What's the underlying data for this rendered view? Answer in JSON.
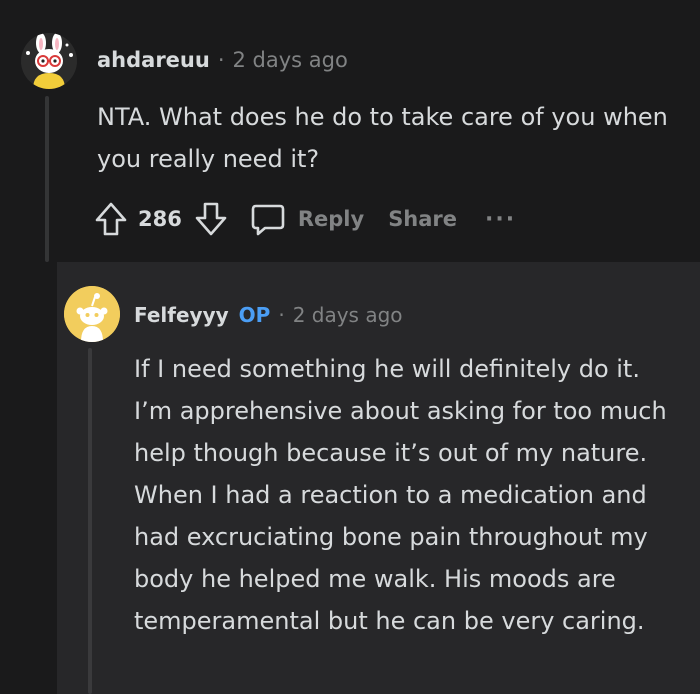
{
  "top_comment": {
    "username": "ahdareuu",
    "separator": "·",
    "timestamp": "2 days ago",
    "body": "NTA. What does he do to take care of you when you really need it?",
    "vote_count": "286",
    "reply_label": "Reply",
    "share_label": "Share",
    "more_label": "···",
    "avatar_icon": "avatar-bunny-glasses-icon"
  },
  "reply_comment": {
    "username": "Felfeyyy",
    "op_badge": "OP",
    "separator": "·",
    "timestamp": "2 days ago",
    "body": "If I need something he will definitely do it. I’m apprehensive about asking for too much help though because it’s out of my nature. When I had a reaction to a medication and had excruciating bone pain throughout my body he helped me walk. His moods are temperamental but he can be very caring.",
    "avatar_icon": "avatar-snoo-yellow-icon"
  },
  "colors": {
    "background": "#1a1a1b",
    "reply_background": "#272729",
    "text": "#d7dadc",
    "muted": "#818384",
    "op_badge": "#4b9ef5",
    "avatar_yellow": "#f2cd5d"
  }
}
